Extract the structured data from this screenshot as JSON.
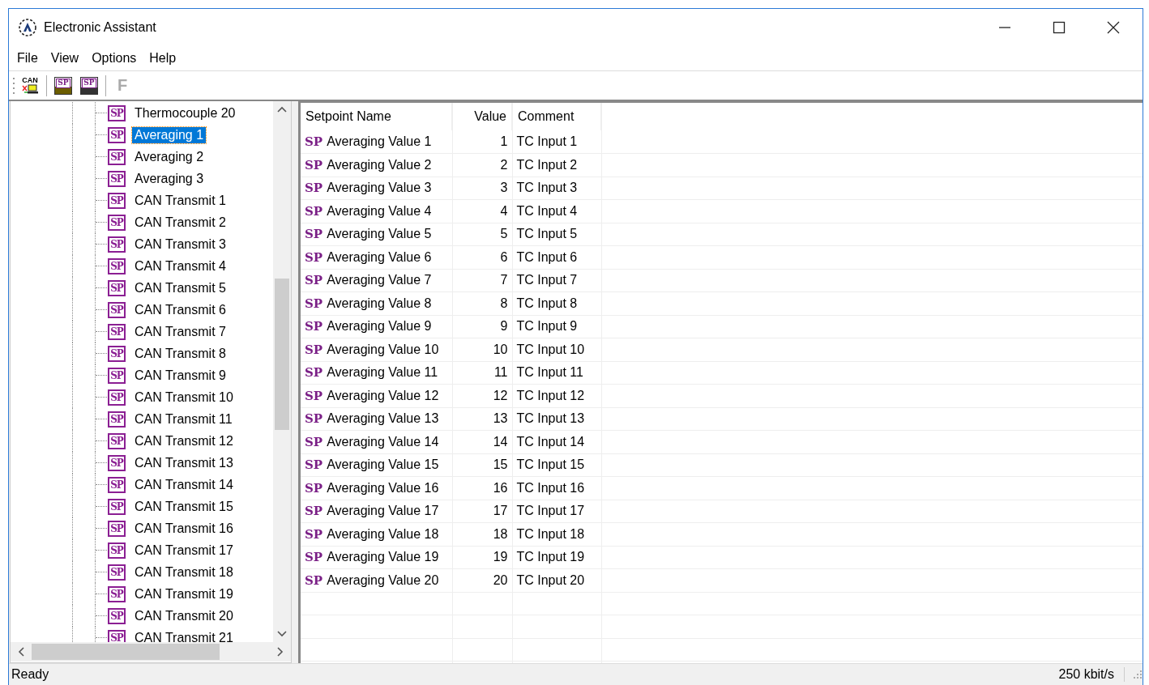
{
  "window": {
    "title": "Electronic Assistant"
  },
  "menu": [
    "File",
    "View",
    "Options",
    "Help"
  ],
  "toolbar": [
    {
      "kind": "can",
      "label": "CAN",
      "disabled": false
    },
    {
      "kind": "separator"
    },
    {
      "kind": "open",
      "label": "SP",
      "disabled": false
    },
    {
      "kind": "save",
      "label": "SP",
      "disabled": false
    },
    {
      "kind": "separator"
    },
    {
      "kind": "text",
      "label": "F",
      "disabled": true
    }
  ],
  "tree": {
    "items": [
      {
        "icon": "SP",
        "label": "Thermocouple 20",
        "selected": false
      },
      {
        "icon": "SP",
        "label": "Averaging 1",
        "selected": true
      },
      {
        "icon": "SP",
        "label": "Averaging 2",
        "selected": false
      },
      {
        "icon": "SP",
        "label": "Averaging 3",
        "selected": false
      },
      {
        "icon": "SP",
        "label": "CAN Transmit 1",
        "selected": false
      },
      {
        "icon": "SP",
        "label": "CAN Transmit 2",
        "selected": false
      },
      {
        "icon": "SP",
        "label": "CAN Transmit 3",
        "selected": false
      },
      {
        "icon": "SP",
        "label": "CAN Transmit 4",
        "selected": false
      },
      {
        "icon": "SP",
        "label": "CAN Transmit 5",
        "selected": false
      },
      {
        "icon": "SP",
        "label": "CAN Transmit 6",
        "selected": false
      },
      {
        "icon": "SP",
        "label": "CAN Transmit 7",
        "selected": false
      },
      {
        "icon": "SP",
        "label": "CAN Transmit 8",
        "selected": false
      },
      {
        "icon": "SP",
        "label": "CAN Transmit 9",
        "selected": false
      },
      {
        "icon": "SP",
        "label": "CAN Transmit 10",
        "selected": false
      },
      {
        "icon": "SP",
        "label": "CAN Transmit 11",
        "selected": false
      },
      {
        "icon": "SP",
        "label": "CAN Transmit 12",
        "selected": false
      },
      {
        "icon": "SP",
        "label": "CAN Transmit 13",
        "selected": false
      },
      {
        "icon": "SP",
        "label": "CAN Transmit 14",
        "selected": false
      },
      {
        "icon": "SP",
        "label": "CAN Transmit 15",
        "selected": false
      },
      {
        "icon": "SP",
        "label": "CAN Transmit 16",
        "selected": false
      },
      {
        "icon": "SP",
        "label": "CAN Transmit 17",
        "selected": false
      },
      {
        "icon": "SP",
        "label": "CAN Transmit 18",
        "selected": false
      },
      {
        "icon": "SP",
        "label": "CAN Transmit 19",
        "selected": false
      },
      {
        "icon": "SP",
        "label": "CAN Transmit 20",
        "selected": false
      },
      {
        "icon": "SP",
        "label": "CAN Transmit 21",
        "selected": false
      }
    ]
  },
  "table": {
    "columns": [
      "Setpoint Name",
      "Value",
      "Comment"
    ],
    "rows": [
      {
        "icon": "SP",
        "name": "Averaging Value 1",
        "value": "1",
        "comment": "TC Input 1"
      },
      {
        "icon": "SP",
        "name": "Averaging Value 2",
        "value": "2",
        "comment": "TC Input 2"
      },
      {
        "icon": "SP",
        "name": "Averaging Value 3",
        "value": "3",
        "comment": "TC Input 3"
      },
      {
        "icon": "SP",
        "name": "Averaging Value 4",
        "value": "4",
        "comment": "TC Input 4"
      },
      {
        "icon": "SP",
        "name": "Averaging Value 5",
        "value": "5",
        "comment": "TC Input 5"
      },
      {
        "icon": "SP",
        "name": "Averaging Value 6",
        "value": "6",
        "comment": "TC Input 6"
      },
      {
        "icon": "SP",
        "name": "Averaging Value 7",
        "value": "7",
        "comment": "TC Input 7"
      },
      {
        "icon": "SP",
        "name": "Averaging Value 8",
        "value": "8",
        "comment": "TC Input 8"
      },
      {
        "icon": "SP",
        "name": "Averaging Value 9",
        "value": "9",
        "comment": "TC Input 9"
      },
      {
        "icon": "SP",
        "name": "Averaging Value 10",
        "value": "10",
        "comment": "TC Input 10"
      },
      {
        "icon": "SP",
        "name": "Averaging Value 11",
        "value": "11",
        "comment": "TC Input 11"
      },
      {
        "icon": "SP",
        "name": "Averaging Value 12",
        "value": "12",
        "comment": "TC Input 12"
      },
      {
        "icon": "SP",
        "name": "Averaging Value 13",
        "value": "13",
        "comment": "TC Input 13"
      },
      {
        "icon": "SP",
        "name": "Averaging Value 14",
        "value": "14",
        "comment": "TC Input 14"
      },
      {
        "icon": "SP",
        "name": "Averaging Value 15",
        "value": "15",
        "comment": "TC Input 15"
      },
      {
        "icon": "SP",
        "name": "Averaging Value 16",
        "value": "16",
        "comment": "TC Input 16"
      },
      {
        "icon": "SP",
        "name": "Averaging Value 17",
        "value": "17",
        "comment": "TC Input 17"
      },
      {
        "icon": "SP",
        "name": "Averaging Value 18",
        "value": "18",
        "comment": "TC Input 18"
      },
      {
        "icon": "SP",
        "name": "Averaging Value 19",
        "value": "19",
        "comment": "TC Input 19"
      },
      {
        "icon": "SP",
        "name": "Averaging Value 20",
        "value": "20",
        "comment": "TC Input 20"
      }
    ]
  },
  "status_bar": {
    "message": "Ready",
    "baud_rate": "250 kbit/s"
  }
}
